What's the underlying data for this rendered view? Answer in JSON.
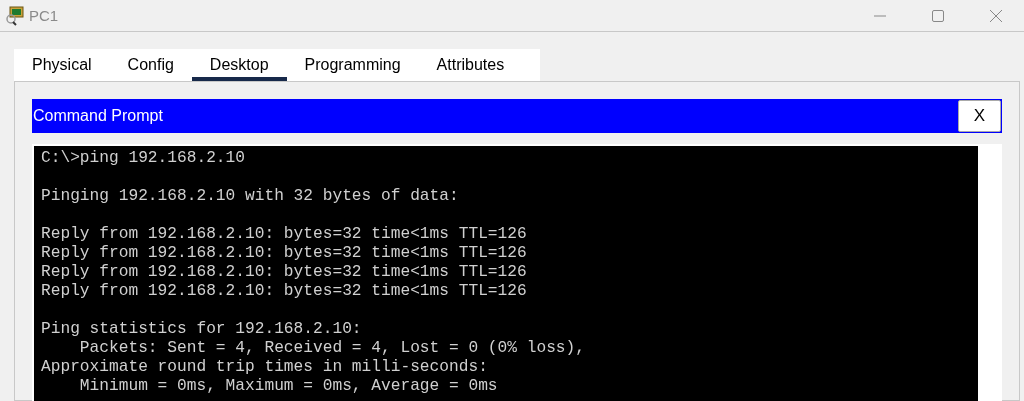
{
  "window": {
    "title": "PC1"
  },
  "tabs": [
    {
      "label": "Physical",
      "selected": false
    },
    {
      "label": "Config",
      "selected": false
    },
    {
      "label": "Desktop",
      "selected": true
    },
    {
      "label": "Programming",
      "selected": false
    },
    {
      "label": "Attributes",
      "selected": false
    }
  ],
  "command_prompt": {
    "title": "Command Prompt",
    "close_label": "X",
    "blocks": [
      [
        "C:\\>ping 192.168.2.10"
      ],
      [
        "Pinging 192.168.2.10 with 32 bytes of data:"
      ],
      [
        "Reply from 192.168.2.10: bytes=32 time<1ms TTL=126",
        "Reply from 192.168.2.10: bytes=32 time<1ms TTL=126",
        "Reply from 192.168.2.10: bytes=32 time<1ms TTL=126",
        "Reply from 192.168.2.10: bytes=32 time<1ms TTL=126"
      ],
      [
        "Ping statistics for 192.168.2.10:",
        "    Packets: Sent = 4, Received = 4, Lost = 0 (0% loss),",
        "Approximate round trip times in milli-seconds:",
        "    Minimum = 0ms, Maximum = 0ms, Average = 0ms"
      ]
    ]
  }
}
